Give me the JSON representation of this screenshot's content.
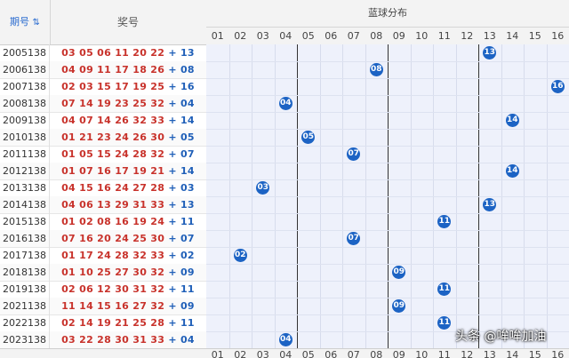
{
  "header": {
    "period_label": "期号",
    "period_sort_icon": "sort-icon",
    "numbers_label": "奖号",
    "distribution_label": "蓝球分布",
    "columns": [
      "01",
      "02",
      "03",
      "04",
      "05",
      "06",
      "07",
      "08",
      "09",
      "10",
      "11",
      "12",
      "13",
      "14",
      "15",
      "16"
    ]
  },
  "rows": [
    {
      "period": "2005138",
      "red": "03 05 06 11 20 22",
      "blue": "13"
    },
    {
      "period": "2006138",
      "red": "04 09 11 17 18 26",
      "blue": "08"
    },
    {
      "period": "2007138",
      "red": "02 03 15 17 19 25",
      "blue": "16"
    },
    {
      "period": "2008138",
      "red": "07 14 19 23 25 32",
      "blue": "04"
    },
    {
      "period": "2009138",
      "red": "04 07 14 26 32 33",
      "blue": "14"
    },
    {
      "period": "2010138",
      "red": "01 21 23 24 26 30",
      "blue": "05"
    },
    {
      "period": "2011138",
      "red": "01 05 15 24 28 32",
      "blue": "07"
    },
    {
      "period": "2012138",
      "red": "01 07 16 17 19 21",
      "blue": "14"
    },
    {
      "period": "2013138",
      "red": "04 15 16 24 27 28",
      "blue": "03"
    },
    {
      "period": "2014138",
      "red": "04 06 13 29 31 33",
      "blue": "13"
    },
    {
      "period": "2015138",
      "red": "01 02 08 16 19 24",
      "blue": "11"
    },
    {
      "period": "2016138",
      "red": "07 16 20 24 25 30",
      "blue": "07"
    },
    {
      "period": "2017138",
      "red": "01 17 24 28 32 33",
      "blue": "02"
    },
    {
      "period": "2018138",
      "red": "01 10 25 27 30 32",
      "blue": "09"
    },
    {
      "period": "2019138",
      "red": "02 06 12 30 31 32",
      "blue": "11"
    },
    {
      "period": "2021138",
      "red": "11 14 15 16 27 32",
      "blue": "09"
    },
    {
      "period": "2022138",
      "red": "02 14 19 21 25 28",
      "blue": "11"
    },
    {
      "period": "2023138",
      "red": "03 22 28 30 31 33",
      "blue": "04"
    }
  ],
  "plus_sign": "+",
  "watermark": "头条 @哞哞加油",
  "colors": {
    "red_ball": "#c8322b",
    "blue_ball": "#1f5fb8",
    "ball_fill": "#1c63c4",
    "grid_bg": "#eef1fb"
  }
}
